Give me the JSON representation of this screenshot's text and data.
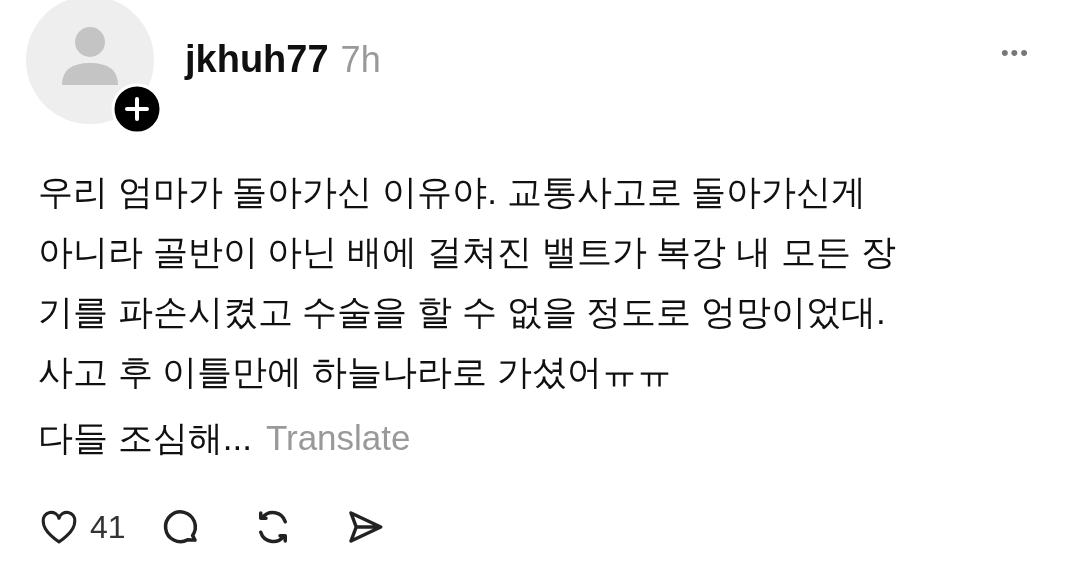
{
  "post": {
    "author": "jkhuh77",
    "time": "7h",
    "more": "•••",
    "lines": [
      "우리 엄마가 돌아가신 이유야. 교통사고로 돌아가신게",
      "아니라 골반이 아닌 배에 걸쳐진 밸트가 복강 내 모든 장",
      "기를 파손시켰고 수술을 할 수 없을 정도로 엉망이었대.",
      "사고 후 이틀만에 하늘나라로 가셨어ㅠㅠ",
      "다들 조심해..."
    ],
    "translate": "Translate",
    "likes": "41"
  }
}
